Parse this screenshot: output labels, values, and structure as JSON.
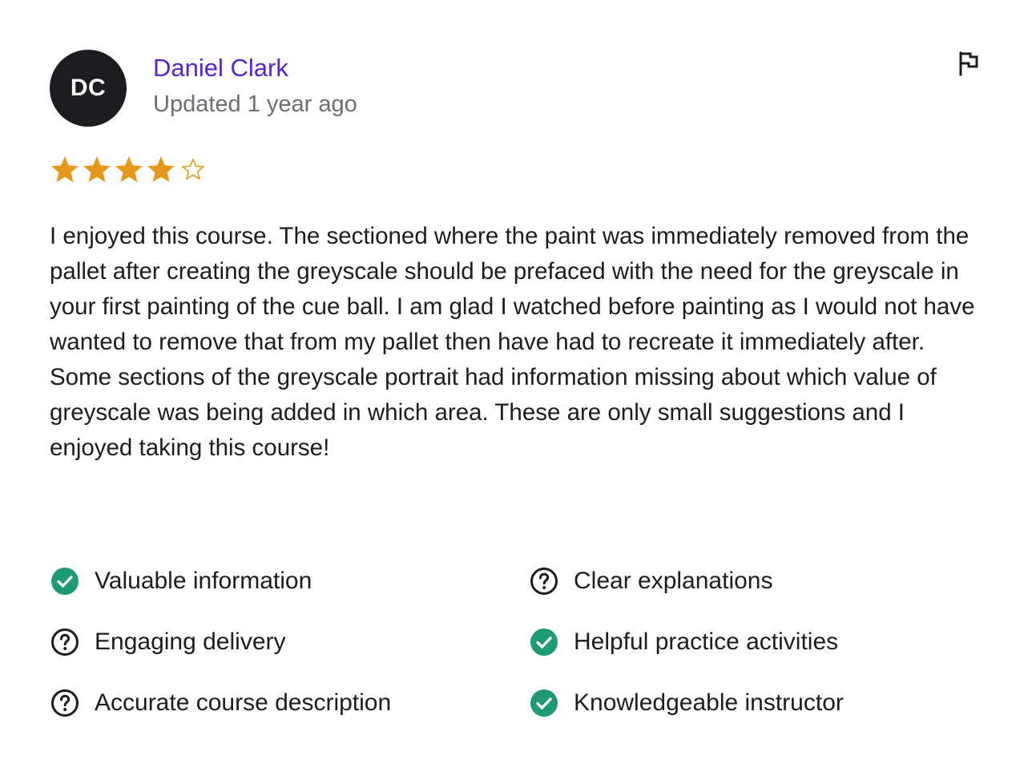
{
  "reviewer": {
    "initials": "DC",
    "name": "Daniel Clark",
    "updated": "Updated 1 year ago"
  },
  "rating": {
    "value": 4,
    "max": 5,
    "star_color": "#e59819"
  },
  "review": {
    "text": "I enjoyed this course. The sectioned where the paint was immediately removed from the pallet after creating the greyscale should be prefaced with the need for the greyscale in your first painting of the cue ball. I am glad I watched before painting as I would not have wanted to remove that from my pallet then have had to recreate it immediately after. Some sections of the greyscale portrait had information missing about which value of greyscale was being added in which area. These are only small suggestions and I enjoyed taking this course!"
  },
  "features": [
    {
      "label": "Valuable information",
      "status": "check"
    },
    {
      "label": "Clear explanations",
      "status": "question"
    },
    {
      "label": "Engaging delivery",
      "status": "question"
    },
    {
      "label": "Helpful practice activities",
      "status": "check"
    },
    {
      "label": "Accurate course description",
      "status": "question"
    },
    {
      "label": "Knowledgeable instructor",
      "status": "check"
    }
  ],
  "colors": {
    "name_link": "#5624d0",
    "check": "#1e9a75",
    "text": "#1c1d1f",
    "muted": "#6a6f73"
  },
  "icons": {
    "report": "flag-icon",
    "check": "check-circle-icon",
    "question": "question-circle-icon"
  }
}
